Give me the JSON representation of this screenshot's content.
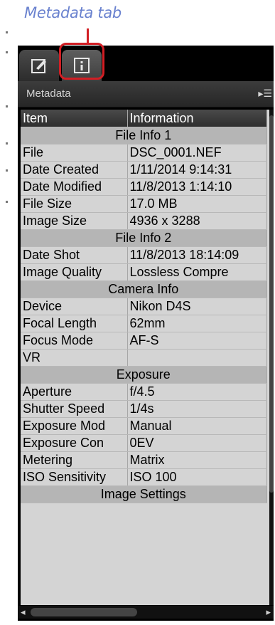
{
  "callout": {
    "label": "Metadata tab"
  },
  "tabs": [
    {
      "name": "edit",
      "icon": "pencil-edit-icon"
    },
    {
      "name": "metadata",
      "icon": "info-icon"
    }
  ],
  "panel": {
    "title": "Metadata",
    "menu_icon": "▸☰"
  },
  "table": {
    "headers": [
      "Item",
      "Information"
    ],
    "rows": [
      {
        "section": "File Info 1"
      },
      {
        "item": "File",
        "info": "DSC_0001.NEF"
      },
      {
        "item": "Date Created",
        "info": "1/11/2014 9:14:31"
      },
      {
        "item": "Date Modified",
        "info": "11/8/2013 1:14:10"
      },
      {
        "item": "File Size",
        "info": "17.0 MB"
      },
      {
        "item": "Image Size",
        "info": "4936 x 3288"
      },
      {
        "section": "File Info 2"
      },
      {
        "item": "Date Shot",
        "info": "11/8/2013 18:14:09"
      },
      {
        "item": "Image Quality",
        "info": "Lossless Compre"
      },
      {
        "section": "Camera Info"
      },
      {
        "item": "Device",
        "info": "Nikon D4S"
      },
      {
        "item": "Focal Length",
        "info": "62mm"
      },
      {
        "item": "Focus Mode",
        "info": "AF-S"
      },
      {
        "item": "VR",
        "info": ""
      },
      {
        "section": "Exposure"
      },
      {
        "item": "Aperture",
        "info": "f/4.5"
      },
      {
        "item": "Shutter Speed",
        "info": "1/4s"
      },
      {
        "item": "Exposure Mod",
        "info": "Manual"
      },
      {
        "item": "Exposure Con",
        "info": "0EV"
      },
      {
        "item": "Metering",
        "info": "Matrix"
      },
      {
        "item": "ISO Sensitivity",
        "info": "ISO 100"
      },
      {
        "section": "Image Settings"
      }
    ]
  },
  "colors": {
    "callout_red": "#d21f25",
    "callout_text": "#6a82cf",
    "panel_bg": "#000000",
    "cell_bg": "#d4d4d4",
    "section_bg": "#b5b5b5"
  }
}
